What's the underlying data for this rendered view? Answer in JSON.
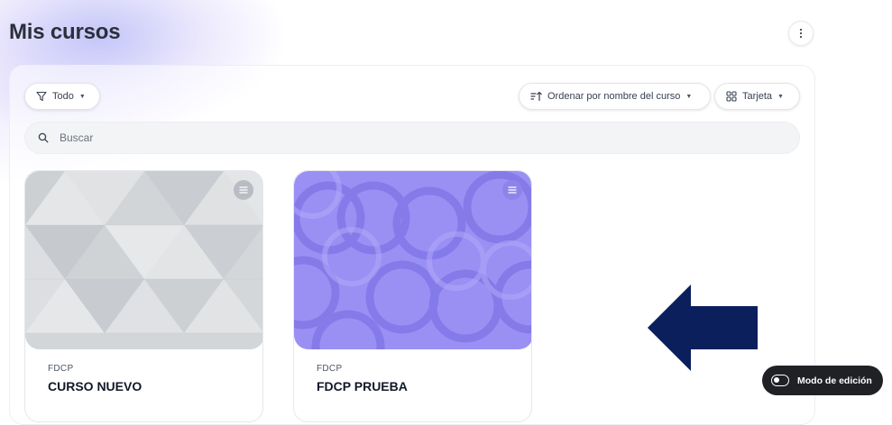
{
  "page": {
    "title": "Mis cursos"
  },
  "toolbar": {
    "filter_label": "Todo",
    "sort_label": "Ordenar por nombre del curso",
    "view_label": "Tarjeta"
  },
  "search": {
    "placeholder": "Buscar",
    "value": ""
  },
  "courses": [
    {
      "category": "FDCP",
      "name": "CURSO NUEVO",
      "pattern": "grey-triangles",
      "pattern_color": "#d7dadd"
    },
    {
      "category": "FDCP",
      "name": "FDCP PRUEBA",
      "pattern": "purple-circles",
      "pattern_color": "#9a8ff5"
    }
  ],
  "edit_mode": {
    "label": "Modo de edición",
    "enabled": false
  },
  "icons": {
    "menu": "kebab-icon",
    "filter": "funnel-icon",
    "sort": "sort-icon",
    "view": "grid-icon",
    "search": "search-icon",
    "course_menu": "list-icon"
  },
  "colors": {
    "accent": "#0a1f5c",
    "dark_pill": "#1f2125"
  }
}
